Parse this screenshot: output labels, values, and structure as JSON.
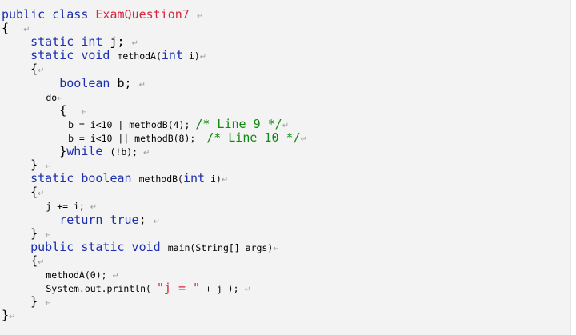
{
  "code": {
    "lines": [
      {
        "segments": [
          {
            "t": "public class ",
            "c": "kw",
            "s": "big"
          },
          {
            "t": "ExamQuestion7",
            "c": "cls",
            "s": "big"
          },
          {
            "t": " ",
            "c": "",
            "s": "big"
          },
          {
            "t": "↵",
            "c": "ret",
            "s": "small"
          }
        ]
      },
      {
        "segments": [
          {
            "t": "{  ",
            "c": "",
            "s": "big"
          },
          {
            "t": "↵",
            "c": "ret",
            "s": "small"
          }
        ]
      },
      {
        "segments": [
          {
            "t": "    static int ",
            "c": "kw",
            "s": "big"
          },
          {
            "t": "j; ",
            "c": "",
            "s": "big"
          },
          {
            "t": "↵",
            "c": "ret",
            "s": "small"
          }
        ]
      },
      {
        "segments": [
          {
            "t": "    static void ",
            "c": "kw",
            "s": "big"
          },
          {
            "t": "methodA(",
            "c": "",
            "s": "small"
          },
          {
            "t": "int",
            "c": "kw",
            "s": "big"
          },
          {
            "t": " i)",
            "c": "",
            "s": "small"
          },
          {
            "t": "↵",
            "c": "ret",
            "s": "small"
          }
        ]
      },
      {
        "segments": [
          {
            "t": "    {",
            "c": "",
            "s": "big"
          },
          {
            "t": "↵",
            "c": "ret",
            "s": "small"
          }
        ]
      },
      {
        "segments": [
          {
            "t": "        boolean ",
            "c": "kw",
            "s": "big"
          },
          {
            "t": "b; ",
            "c": "",
            "s": "big"
          },
          {
            "t": "↵",
            "c": "ret",
            "s": "small"
          }
        ]
      },
      {
        "segments": [
          {
            "t": "        do",
            "c": "",
            "s": "small"
          },
          {
            "t": "↵",
            "c": "ret",
            "s": "small"
          }
        ]
      },
      {
        "segments": [
          {
            "t": "        {  ",
            "c": "",
            "s": "big"
          },
          {
            "t": "↵",
            "c": "ret",
            "s": "small"
          }
        ]
      },
      {
        "segments": [
          {
            "t": "            b = i<10 | methodB(4); ",
            "c": "",
            "s": "small"
          },
          {
            "t": "/* Line 9 */",
            "c": "cm",
            "s": "big"
          },
          {
            "t": "↵",
            "c": "ret",
            "s": "small"
          }
        ]
      },
      {
        "segments": [
          {
            "t": "            b = i<10 || methodB(8);  ",
            "c": "",
            "s": "small"
          },
          {
            "t": "/* Line 10 */",
            "c": "cm",
            "s": "big"
          },
          {
            "t": "↵",
            "c": "ret",
            "s": "small"
          }
        ]
      },
      {
        "segments": [
          {
            "t": "        }",
            "c": "",
            "s": "big"
          },
          {
            "t": "while ",
            "c": "kw",
            "s": "big"
          },
          {
            "t": "(!b); ",
            "c": "",
            "s": "small"
          },
          {
            "t": "↵",
            "c": "ret",
            "s": "small"
          }
        ]
      },
      {
        "segments": [
          {
            "t": "    } ",
            "c": "",
            "s": "big"
          },
          {
            "t": "↵",
            "c": "ret",
            "s": "small"
          }
        ]
      },
      {
        "segments": [
          {
            "t": "    static boolean ",
            "c": "kw",
            "s": "big"
          },
          {
            "t": "methodB(",
            "c": "",
            "s": "small"
          },
          {
            "t": "int",
            "c": "kw",
            "s": "big"
          },
          {
            "t": " i)",
            "c": "",
            "s": "small"
          },
          {
            "t": "↵",
            "c": "ret",
            "s": "small"
          }
        ]
      },
      {
        "segments": [
          {
            "t": "    {",
            "c": "",
            "s": "big"
          },
          {
            "t": "↵",
            "c": "ret",
            "s": "small"
          }
        ]
      },
      {
        "segments": [
          {
            "t": "        j += i; ",
            "c": "",
            "s": "small"
          },
          {
            "t": "↵",
            "c": "ret",
            "s": "small"
          }
        ]
      },
      {
        "segments": [
          {
            "t": "        return true",
            "c": "kw",
            "s": "big"
          },
          {
            "t": "; ",
            "c": "",
            "s": "big"
          },
          {
            "t": "↵",
            "c": "ret",
            "s": "small"
          }
        ]
      },
      {
        "segments": [
          {
            "t": "    } ",
            "c": "",
            "s": "big"
          },
          {
            "t": "↵",
            "c": "ret",
            "s": "small"
          }
        ]
      },
      {
        "segments": [
          {
            "t": "    public static void ",
            "c": "kw",
            "s": "big"
          },
          {
            "t": "main(String[] args)",
            "c": "",
            "s": "small"
          },
          {
            "t": "↵",
            "c": "ret",
            "s": "small"
          }
        ]
      },
      {
        "segments": [
          {
            "t": "    {",
            "c": "",
            "s": "big"
          },
          {
            "t": "↵",
            "c": "ret",
            "s": "small"
          }
        ]
      },
      {
        "segments": [
          {
            "t": "        methodA(0); ",
            "c": "",
            "s": "small"
          },
          {
            "t": "↵",
            "c": "ret",
            "s": "small"
          }
        ]
      },
      {
        "segments": [
          {
            "t": "        System.out.println( ",
            "c": "",
            "s": "small"
          },
          {
            "t": "\"j = \"",
            "c": "str",
            "s": "big"
          },
          {
            "t": " + j ); ",
            "c": "",
            "s": "small"
          },
          {
            "t": "↵",
            "c": "ret",
            "s": "small"
          }
        ]
      },
      {
        "segments": [
          {
            "t": "    } ",
            "c": "",
            "s": "big"
          },
          {
            "t": "↵",
            "c": "ret",
            "s": "small"
          }
        ]
      },
      {
        "segments": [
          {
            "t": "}",
            "c": "",
            "s": "big"
          },
          {
            "t": "↵",
            "c": "ret",
            "s": "small"
          }
        ]
      }
    ]
  }
}
